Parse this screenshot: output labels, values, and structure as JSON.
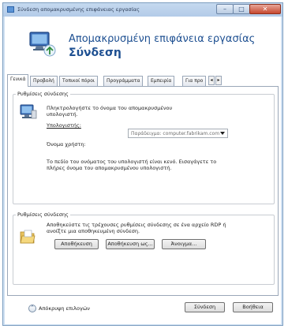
{
  "window": {
    "title": "Σύνδεση απομακρυσμένης επιφάνειας εργασίας",
    "minimize_glyph": "–",
    "maximize_glyph": "□",
    "close_glyph": "✕",
    "title_icon": "remote-desktop-icon"
  },
  "banner": {
    "line1": "Απομακρυσμένη επιφάνεια εργασίας",
    "line2": "Σύνδεση",
    "icon": "remote-desktop-icon"
  },
  "tabs": [
    {
      "label": "Γενικά",
      "active": true
    },
    {
      "label": "Προβολή",
      "active": false
    },
    {
      "label": "Τοπικοί πόροι",
      "active": false
    },
    {
      "label": "Προγράμματα",
      "active": false
    },
    {
      "label": "Εμπειρία",
      "active": false
    },
    {
      "label": "Για προ",
      "active": false
    }
  ],
  "tab_scroll": {
    "left": "◂",
    "right": "▸"
  },
  "logon_settings": {
    "title": "Ρυθμίσεις σύνδεσης",
    "icon": "computer-monitor-icon",
    "instruction": "Πληκτρολογήστε το όνομα του απομακρυσμένου υπολογιστή.",
    "computer_label": "Υπολογιστής:",
    "computer_value": "Παράδειγμα: computer.fabrikam.com",
    "user_label": "Όνομα χρήστη:",
    "user_value": "",
    "hint": "Το πεδίο του ονόματος του υπολογιστή είναι κενό. Εισαγάγετε το πλήρες όνομα του απομακρυσμένου υπολογιστή."
  },
  "connection_settings": {
    "title": "Ρυθμίσεις σύνδεσης",
    "icon": "folder-icon",
    "description": "Αποθηκεύστε τις τρέχουσες ρυθμίσεις σύνδεσης σε ένα αρχείο RDP ή ανοίξτε μια αποθηκευμένη σύνδεση.",
    "save_label": "Αποθήκευση",
    "save_as_label": "Αποθήκευση ως...",
    "open_label": "Άνοιγμα..."
  },
  "footer": {
    "options_label": "Απόκρυψη επιλογών",
    "options_icon": "chevron-up-icon",
    "connect_label": "Σύνδεση",
    "help_label": "Βοήθεια"
  },
  "colors": {
    "accent": "#1d4f91",
    "window_frame": "#cfe0f2",
    "close_button": "#c6482f"
  }
}
